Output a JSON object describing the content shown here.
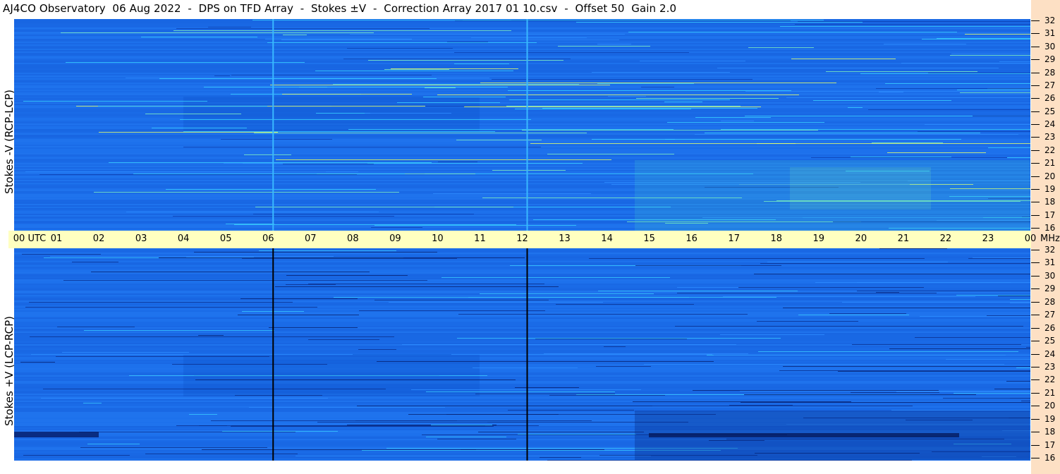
{
  "title": "AJ4CO Observatory  06 Aug 2022  -  DPS on TFD Array  -  Stokes ±V  -  Correction Array 2017 01 10.csv  -  Offset 50  Gain 2.0",
  "top_panel": {
    "ylabel": "Stokes -V (RCP-LCP)"
  },
  "bottom_panel": {
    "ylabel": "Stokes +V (LCP-RCP)"
  },
  "time_axis": {
    "first_label": "00  UTC",
    "labels": [
      "01",
      "02",
      "03",
      "04",
      "05",
      "06",
      "07",
      "08",
      "09",
      "10",
      "11",
      "12",
      "13",
      "14",
      "15",
      "16",
      "17",
      "18",
      "19",
      "20",
      "21",
      "22",
      "23"
    ],
    "last_label": "00",
    "unit": "MHz"
  },
  "freq_axis": {
    "labels": [
      "32",
      "31",
      "30",
      "29",
      "28",
      "27",
      "26",
      "25",
      "24",
      "23",
      "22",
      "21",
      "20",
      "19",
      "18",
      "17",
      "16"
    ]
  },
  "colors": {
    "spectrogram_base": "#1a6ae6",
    "time_strip": "#ffffc0",
    "right_strip": "#fde0c4",
    "top_marker_line": "#39b8ff",
    "bottom_marker_line": "#000000"
  },
  "markers_utc": [
    6.1,
    12.1
  ]
}
